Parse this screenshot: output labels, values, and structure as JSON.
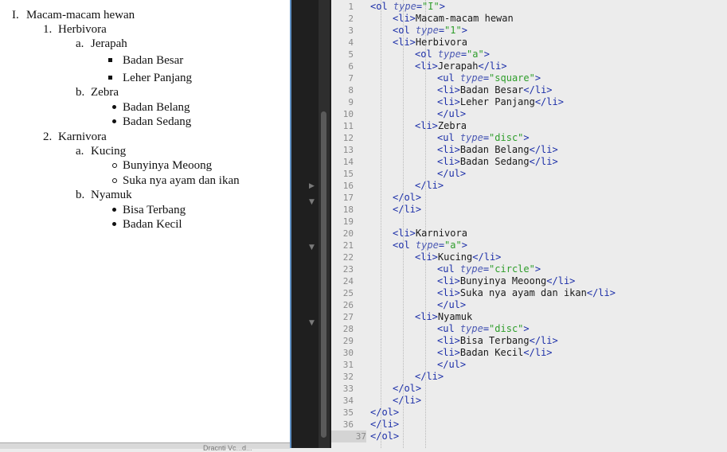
{
  "preview": {
    "items": [
      {
        "marker": "I.",
        "text": "Macam-macam hewan",
        "kind": "text"
      },
      {
        "marker": "1.",
        "text": "Herbivora",
        "kind": "text"
      },
      {
        "marker": "a.",
        "text": "Jerapah",
        "kind": "text"
      },
      {
        "marker": "",
        "text": "Badan Besar",
        "kind": "square"
      },
      {
        "marker": "",
        "text": "Leher Panjang",
        "kind": "square"
      },
      {
        "marker": "b.",
        "text": "Zebra",
        "kind": "text"
      },
      {
        "marker": "",
        "text": "Badan Belang",
        "kind": "disc"
      },
      {
        "marker": "",
        "text": "Badan Sedang",
        "kind": "disc"
      },
      {
        "marker": "2.",
        "text": "Karnivora",
        "kind": "text"
      },
      {
        "marker": "a.",
        "text": "Kucing",
        "kind": "text"
      },
      {
        "marker": "",
        "text": "Bunyinya Meoong",
        "kind": "circle"
      },
      {
        "marker": "",
        "text": "Suka nya ayam dan ikan",
        "kind": "circle"
      },
      {
        "marker": "b.",
        "text": "Nyamuk",
        "kind": "text"
      },
      {
        "marker": "",
        "text": "Bisa Terbang",
        "kind": "disc"
      },
      {
        "marker": "",
        "text": "Badan Kecil",
        "kind": "disc"
      }
    ],
    "statusbar_clip": "Dracnti Vc...d..."
  },
  "editor": {
    "active_line": 37,
    "lines": [
      {
        "n": "1",
        "parts": [
          [
            "t",
            "<ol "
          ],
          [
            "a",
            "type"
          ],
          [
            "t",
            "="
          ],
          [
            "s",
            "\"I\""
          ],
          [
            "t",
            ">"
          ]
        ]
      },
      {
        "n": "2",
        "parts": [
          [
            "t",
            "<li>"
          ],
          [
            "p",
            "Macam-macam hewan"
          ]
        ]
      },
      {
        "n": "3",
        "parts": [
          [
            "t",
            "<ol "
          ],
          [
            "a",
            "type"
          ],
          [
            "t",
            "="
          ],
          [
            "s",
            "\"1\""
          ],
          [
            "t",
            ">"
          ]
        ]
      },
      {
        "n": "4",
        "parts": [
          [
            "t",
            "<li>"
          ],
          [
            "p",
            "Herbivora"
          ]
        ]
      },
      {
        "n": "5",
        "parts": [
          [
            "t",
            "<ol "
          ],
          [
            "a",
            "type"
          ],
          [
            "t",
            "="
          ],
          [
            "s",
            "\"a\""
          ],
          [
            "t",
            ">"
          ]
        ]
      },
      {
        "n": "6",
        "parts": [
          [
            "t",
            "<li>"
          ],
          [
            "p",
            "Jerapah"
          ],
          [
            "t",
            "</li>"
          ]
        ]
      },
      {
        "n": "7",
        "parts": [
          [
            "t",
            "<ul "
          ],
          [
            "a",
            "type"
          ],
          [
            "t",
            "="
          ],
          [
            "s",
            "\"square\""
          ],
          [
            "t",
            ">"
          ]
        ]
      },
      {
        "n": "8",
        "parts": [
          [
            "t",
            "<li>"
          ],
          [
            "p",
            "Badan Besar"
          ],
          [
            "t",
            "</li>"
          ]
        ]
      },
      {
        "n": "9",
        "parts": [
          [
            "t",
            "<li>"
          ],
          [
            "p",
            "Leher Panjang"
          ],
          [
            "t",
            "</li>"
          ]
        ]
      },
      {
        "n": "10",
        "parts": [
          [
            "t",
            "</ul>"
          ]
        ]
      },
      {
        "n": "11",
        "parts": [
          [
            "t",
            "<li>"
          ],
          [
            "p",
            "Zebra"
          ]
        ]
      },
      {
        "n": "12",
        "parts": [
          [
            "t",
            "<ul "
          ],
          [
            "a",
            "type"
          ],
          [
            "t",
            "="
          ],
          [
            "s",
            "\"disc\""
          ],
          [
            "t",
            ">"
          ]
        ]
      },
      {
        "n": "13",
        "parts": [
          [
            "t",
            "<li>"
          ],
          [
            "p",
            "Badan Belang"
          ],
          [
            "t",
            "</li>"
          ]
        ]
      },
      {
        "n": "14",
        "parts": [
          [
            "t",
            "<li>"
          ],
          [
            "p",
            "Badan Sedang"
          ],
          [
            "t",
            "</li>"
          ]
        ]
      },
      {
        "n": "15",
        "parts": [
          [
            "t",
            "</ul>"
          ]
        ]
      },
      {
        "n": "16",
        "parts": [
          [
            "t",
            "</li>"
          ]
        ]
      },
      {
        "n": "17",
        "parts": [
          [
            "t",
            "</ol>"
          ]
        ]
      },
      {
        "n": "18",
        "parts": [
          [
            "t",
            "</li>"
          ]
        ]
      },
      {
        "n": "19",
        "parts": []
      },
      {
        "n": "20",
        "parts": [
          [
            "t",
            "<li>"
          ],
          [
            "p",
            "Karnivora"
          ]
        ]
      },
      {
        "n": "21",
        "parts": [
          [
            "t",
            "<ol "
          ],
          [
            "a",
            "type"
          ],
          [
            "t",
            "="
          ],
          [
            "s",
            "\"a\""
          ],
          [
            "t",
            ">"
          ]
        ]
      },
      {
        "n": "22",
        "parts": [
          [
            "t",
            "<li>"
          ],
          [
            "p",
            "Kucing"
          ],
          [
            "t",
            "</li>"
          ]
        ]
      },
      {
        "n": "23",
        "parts": [
          [
            "t",
            "<ul "
          ],
          [
            "a",
            "type"
          ],
          [
            "t",
            "="
          ],
          [
            "s",
            "\"circle\""
          ],
          [
            "t",
            ">"
          ]
        ]
      },
      {
        "n": "24",
        "parts": [
          [
            "t",
            "<li>"
          ],
          [
            "p",
            "Bunyinya Meoong"
          ],
          [
            "t",
            "</li>"
          ]
        ]
      },
      {
        "n": "25",
        "parts": [
          [
            "t",
            "<li>"
          ],
          [
            "p",
            "Suka nya ayam dan ikan"
          ],
          [
            "t",
            "</li>"
          ]
        ]
      },
      {
        "n": "26",
        "parts": [
          [
            "t",
            "</ul>"
          ]
        ]
      },
      {
        "n": "27",
        "parts": [
          [
            "t",
            "<li>"
          ],
          [
            "p",
            "Nyamuk"
          ]
        ]
      },
      {
        "n": "28",
        "parts": [
          [
            "t",
            "<ul "
          ],
          [
            "a",
            "type"
          ],
          [
            "t",
            "="
          ],
          [
            "s",
            "\"disc\""
          ],
          [
            "t",
            ">"
          ]
        ]
      },
      {
        "n": "29",
        "parts": [
          [
            "t",
            "<li>"
          ],
          [
            "p",
            "Bisa Terbang"
          ],
          [
            "t",
            "</li>"
          ]
        ]
      },
      {
        "n": "30",
        "parts": [
          [
            "t",
            "<li>"
          ],
          [
            "p",
            "Badan Kecil"
          ],
          [
            "t",
            "</li>"
          ]
        ]
      },
      {
        "n": "31",
        "parts": [
          [
            "t",
            "</ul>"
          ]
        ]
      },
      {
        "n": "32",
        "parts": [
          [
            "t",
            "</li>"
          ]
        ]
      },
      {
        "n": "33",
        "parts": [
          [
            "t",
            "</ol>"
          ]
        ]
      },
      {
        "n": "34",
        "parts": [
          [
            "t",
            "</li>"
          ]
        ]
      },
      {
        "n": "35",
        "parts": [
          [
            "t",
            "</ol>"
          ]
        ]
      },
      {
        "n": "36",
        "parts": [
          [
            "t",
            "</li>"
          ]
        ]
      },
      {
        "n": "37",
        "parts": [
          [
            "t",
            "</ol>"
          ]
        ]
      }
    ]
  },
  "colors": {
    "tag": "#1c2fa8",
    "attr": "#4a58b3",
    "string": "#2e9d2a",
    "accent_border": "#5f8fc3"
  },
  "icons": {
    "fold": "fold-arrow-icon"
  }
}
